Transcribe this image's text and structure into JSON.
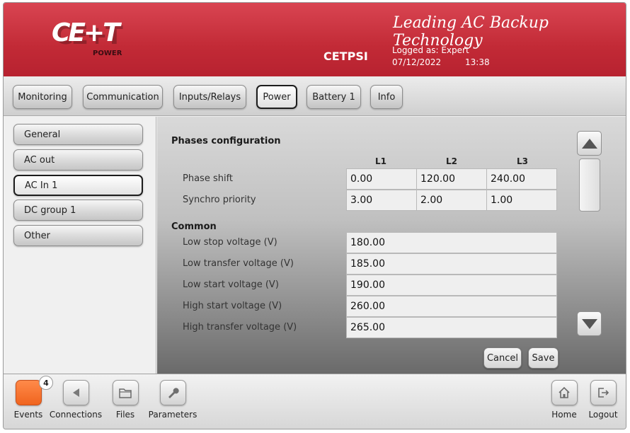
{
  "header": {
    "brand": "CE+T",
    "brand_sub": "POWER",
    "tagline": "Leading AC Backup Technology",
    "device_name": "CETPSI",
    "logged_as": "Logged as: Expert",
    "date": "07/12/2022",
    "time": "13:38"
  },
  "tabs": [
    {
      "label": "Monitoring"
    },
    {
      "label": "Communication"
    },
    {
      "label": "Inputs/Relays"
    },
    {
      "label": "Power",
      "active": true
    },
    {
      "label": "Battery 1"
    },
    {
      "label": "Info"
    }
  ],
  "sidebar": {
    "items": [
      {
        "label": "General"
      },
      {
        "label": "AC out"
      },
      {
        "label": "AC In 1",
        "active": true
      },
      {
        "label": "DC group 1"
      },
      {
        "label": "Other"
      }
    ]
  },
  "main": {
    "phases": {
      "title": "Phases configuration",
      "columns": [
        "L1",
        "L2",
        "L3"
      ],
      "rows": [
        {
          "label": "Phase shift",
          "values": [
            "0.00",
            "120.00",
            "240.00"
          ]
        },
        {
          "label": "Synchro priority",
          "values": [
            "3.00",
            "2.00",
            "1.00"
          ]
        }
      ]
    },
    "common": {
      "title": "Common",
      "rows": [
        {
          "label": "Low stop voltage (V)",
          "value": "180.00"
        },
        {
          "label": "Low transfer voltage (V)",
          "value": "185.00"
        },
        {
          "label": "Low start voltage (V)",
          "value": "190.00"
        },
        {
          "label": "High start voltage (V)",
          "value": "260.00"
        },
        {
          "label": "High transfer voltage (V)",
          "value": "265.00"
        }
      ]
    },
    "cancel_label": "Cancel",
    "save_label": "Save"
  },
  "footer": {
    "events": {
      "label": "Events",
      "badge": "4"
    },
    "connections": {
      "label": "Connections"
    },
    "files": {
      "label": "Files"
    },
    "parameters": {
      "label": "Parameters"
    },
    "home": {
      "label": "Home"
    },
    "logout": {
      "label": "Logout"
    }
  },
  "colors": {
    "header_red": "#c22a36",
    "events_orange": "#f0641e"
  }
}
